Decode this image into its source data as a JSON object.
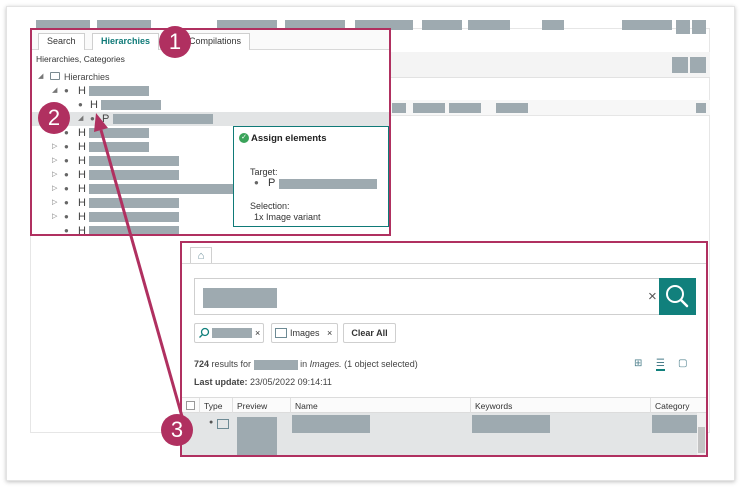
{
  "tabs": [
    {
      "label": "Search"
    },
    {
      "label": "Hierarchies"
    },
    {
      "label": "Compilations"
    }
  ],
  "panel_label": "Hierarchies, Categories",
  "tree": {
    "root_label": "Hierarchies",
    "letters": {
      "h": "H",
      "p": "P"
    }
  },
  "tooltip": {
    "title": "Assign elements",
    "target_label": "Target:",
    "target_letter": "P",
    "selection_label": "Selection:",
    "selection_value": "1x Image variant"
  },
  "search": {
    "chip_images": "Images",
    "clear_all": "Clear All"
  },
  "results": {
    "count": "724",
    "text_for": "results for",
    "text_in": "in",
    "text_scope": "Images.",
    "text_selected": "(1 object selected)",
    "last_update_label": "Last update:",
    "last_update_value": "23/05/2022 09:14:11"
  },
  "table": {
    "columns": [
      "Type",
      "Preview",
      "Name",
      "Keywords",
      "Category"
    ]
  },
  "badges": [
    "1",
    "2",
    "3"
  ],
  "colors": {
    "accent": "#11807c",
    "highlight": "#b03060",
    "redacted": "#9eaab0"
  },
  "icons": {
    "home": "home-icon",
    "search": "search-icon",
    "check": "check-circle-icon",
    "image": "image-icon",
    "folder": "folder-icon"
  }
}
